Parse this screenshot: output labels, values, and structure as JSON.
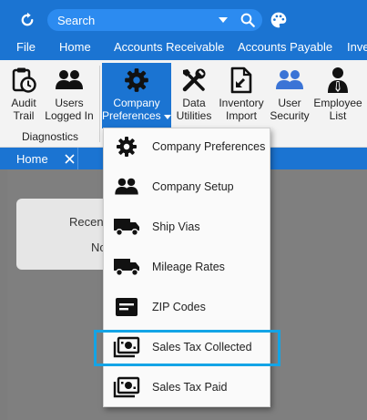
{
  "topbar": {
    "search_placeholder": "Search",
    "icons": [
      "refresh-icon",
      "chevron-down-icon",
      "search-icon",
      "palette-icon"
    ]
  },
  "menubar": {
    "items": [
      "File",
      "Home",
      "Accounts Receivable",
      "Accounts Payable",
      "Inve"
    ]
  },
  "ribbon": {
    "buttons": [
      {
        "line1": "Audit",
        "line2": "Trail",
        "icon": "clipboard-clock-icon"
      },
      {
        "line1": "Users",
        "line2": "Logged In",
        "icon": "users-icon"
      },
      {
        "line1": "Company",
        "line2": "Preferences",
        "icon": "gear-icon"
      },
      {
        "line1": "Data",
        "line2": "Utilities",
        "icon": "tools-icon"
      },
      {
        "line1": "Inventory",
        "line2": "Import",
        "icon": "file-import-icon"
      },
      {
        "line1": "User",
        "line2": "Security",
        "icon": "user-security-icon"
      },
      {
        "line1": "Employee",
        "line2": "List",
        "icon": "employee-icon"
      }
    ],
    "group_label": "Diagnostics"
  },
  "tabs": {
    "home_label": "Home"
  },
  "content": {
    "card_line1": "Recen",
    "card_line2": "No"
  },
  "dropdown": {
    "items": [
      {
        "label": "Company Preferences",
        "icon": "gear-icon"
      },
      {
        "label": "Company Setup",
        "icon": "users-icon"
      },
      {
        "label": "Ship Vias",
        "icon": "truck-icon"
      },
      {
        "label": "Mileage Rates",
        "icon": "truck-icon"
      },
      {
        "label": "ZIP Codes",
        "icon": "card-icon"
      },
      {
        "label": "Sales Tax Collected",
        "icon": "money-stack-icon"
      },
      {
        "label": "Sales Tax Paid",
        "icon": "money-stack-icon"
      }
    ],
    "highlighted": "Sales Tax Collected"
  },
  "colors": {
    "brand_blue": "#1b74d2",
    "search_blue": "#2c8bf0",
    "highlight_cyan": "#13a4e6",
    "content_gray": "#7f7f7f"
  }
}
